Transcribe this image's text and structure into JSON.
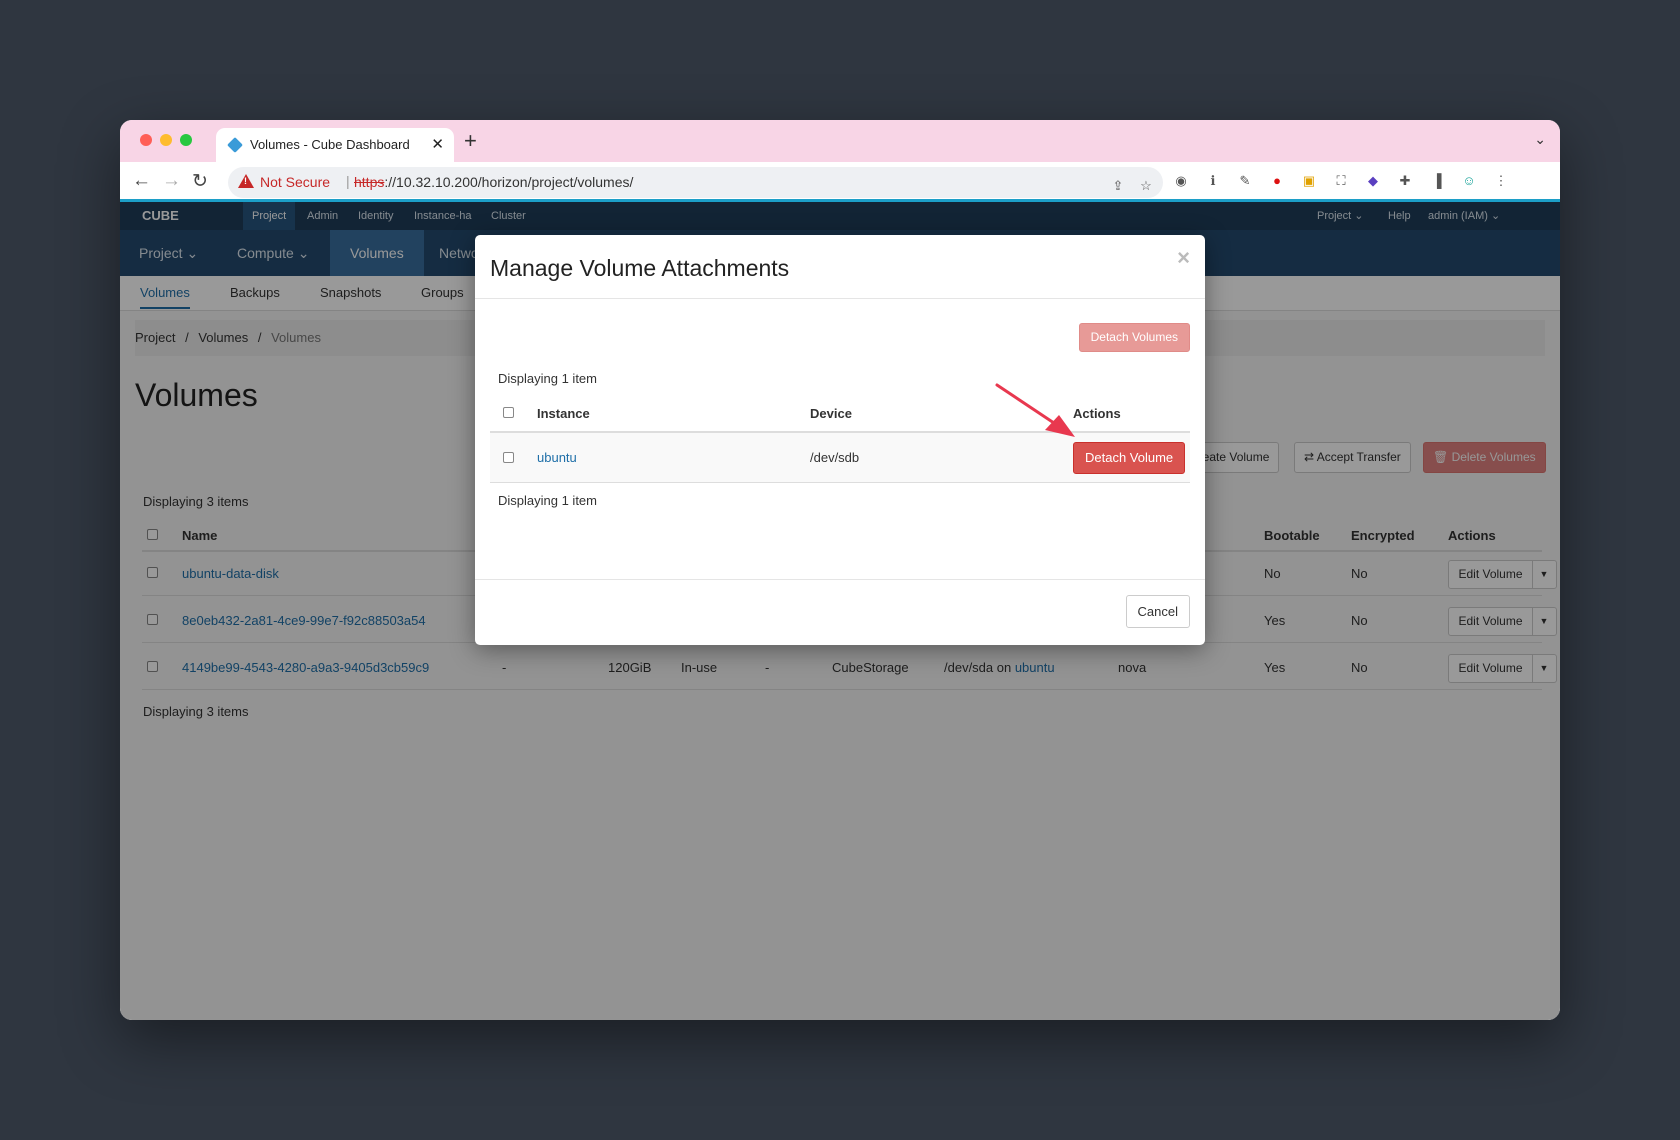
{
  "browser": {
    "tab_title": "Volumes - Cube Dashboard",
    "tab_close": "✕",
    "new_tab": "+",
    "not_secure": "Not Secure",
    "url_scheme": "https",
    "url_rest": "://10.32.10.200/horizon/project/volumes/",
    "tabs_menu": "⌄"
  },
  "topnav": {
    "brand": "CUBE",
    "items": [
      "Project",
      "Admin",
      "Identity",
      "Instance-ha",
      "Cluster"
    ],
    "right": [
      "Project ⌄",
      "Help",
      "admin (IAM) ⌄"
    ]
  },
  "subnav": [
    "Project ⌄",
    "Compute ⌄",
    "Volumes",
    "Netwo"
  ],
  "tabs": [
    "Volumes",
    "Backups",
    "Snapshots",
    "Groups"
  ],
  "breadcrumb": [
    "Project",
    "/",
    "Volumes",
    "/",
    "Volumes"
  ],
  "page_title": "Volumes",
  "page_actions": {
    "create": "Create Volume",
    "accept": "⇄ Accept Transfer",
    "delete": "🗑 Delete Volumes"
  },
  "table": {
    "displaying": "Displaying 3 items",
    "headers": {
      "name": "Name",
      "bootable": "Bootable",
      "encrypted": "Encrypted",
      "actions": "Actions"
    },
    "rows": [
      {
        "name": "ubuntu-data-disk",
        "description": "",
        "size": "",
        "status": "",
        "group": "",
        "type": "",
        "attached": "",
        "attached_link": "",
        "az": "",
        "bootable": "No",
        "encrypted": "No",
        "action": "Edit Volume"
      },
      {
        "name": "8e0eb432-2a81-4ce9-99e7-f92c88503a54",
        "description": "",
        "size": "",
        "status": "",
        "group": "",
        "type": "",
        "attached": "",
        "attached_link": "",
        "az": "",
        "bootable": "Yes",
        "encrypted": "No",
        "action": "Edit Volume"
      },
      {
        "name": "4149be99-4543-4280-a9a3-9405d3cb59c9",
        "description": "-",
        "size": "120GiB",
        "status": "In-use",
        "group": "-",
        "type": "CubeStorage",
        "attached": "/dev/sda on ",
        "attached_link": "ubuntu",
        "az": "nova",
        "bootable": "Yes",
        "encrypted": "No",
        "action": "Edit Volume"
      }
    ]
  },
  "modal": {
    "title": "Manage Volume Attachments",
    "close": "×",
    "detach_volumes": "Detach Volumes",
    "displaying": "Displaying 1 item",
    "headers": {
      "instance": "Instance",
      "device": "Device",
      "actions": "Actions"
    },
    "row": {
      "instance": "ubuntu",
      "device": "/dev/sdb",
      "action": "Detach Volume"
    },
    "cancel": "Cancel"
  },
  "colors": {
    "danger": "#d9534f",
    "link": "#1f6fa8",
    "nav_dark": "#1e3d59",
    "tabstrip": "#f8d5e6",
    "annotation_arrow": "#e8384f"
  }
}
